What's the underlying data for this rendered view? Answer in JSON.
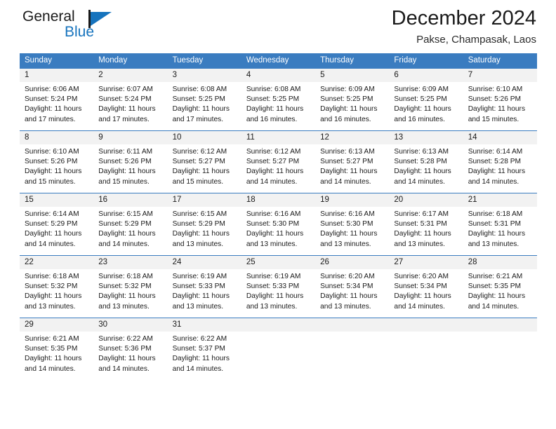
{
  "brand": {
    "name_part1": "General",
    "name_part2": "Blue",
    "logo_icon": "triangle-flag-icon",
    "accent_color": "#1673bd"
  },
  "header": {
    "title": "December 2024",
    "subtitle": "Pakse, Champasak, Laos"
  },
  "calendar": {
    "header_color": "#3a7cc0",
    "day_band_color": "#f2f2f2",
    "weekday_names": [
      "Sunday",
      "Monday",
      "Tuesday",
      "Wednesday",
      "Thursday",
      "Friday",
      "Saturday"
    ],
    "weeks": [
      [
        {
          "day": "1",
          "sunrise": "Sunrise: 6:06 AM",
          "sunset": "Sunset: 5:24 PM",
          "daylight_line1": "Daylight: 11 hours",
          "daylight_line2": "and 17 minutes."
        },
        {
          "day": "2",
          "sunrise": "Sunrise: 6:07 AM",
          "sunset": "Sunset: 5:24 PM",
          "daylight_line1": "Daylight: 11 hours",
          "daylight_line2": "and 17 minutes."
        },
        {
          "day": "3",
          "sunrise": "Sunrise: 6:08 AM",
          "sunset": "Sunset: 5:25 PM",
          "daylight_line1": "Daylight: 11 hours",
          "daylight_line2": "and 17 minutes."
        },
        {
          "day": "4",
          "sunrise": "Sunrise: 6:08 AM",
          "sunset": "Sunset: 5:25 PM",
          "daylight_line1": "Daylight: 11 hours",
          "daylight_line2": "and 16 minutes."
        },
        {
          "day": "5",
          "sunrise": "Sunrise: 6:09 AM",
          "sunset": "Sunset: 5:25 PM",
          "daylight_line1": "Daylight: 11 hours",
          "daylight_line2": "and 16 minutes."
        },
        {
          "day": "6",
          "sunrise": "Sunrise: 6:09 AM",
          "sunset": "Sunset: 5:25 PM",
          "daylight_line1": "Daylight: 11 hours",
          "daylight_line2": "and 16 minutes."
        },
        {
          "day": "7",
          "sunrise": "Sunrise: 6:10 AM",
          "sunset": "Sunset: 5:26 PM",
          "daylight_line1": "Daylight: 11 hours",
          "daylight_line2": "and 15 minutes."
        }
      ],
      [
        {
          "day": "8",
          "sunrise": "Sunrise: 6:10 AM",
          "sunset": "Sunset: 5:26 PM",
          "daylight_line1": "Daylight: 11 hours",
          "daylight_line2": "and 15 minutes."
        },
        {
          "day": "9",
          "sunrise": "Sunrise: 6:11 AM",
          "sunset": "Sunset: 5:26 PM",
          "daylight_line1": "Daylight: 11 hours",
          "daylight_line2": "and 15 minutes."
        },
        {
          "day": "10",
          "sunrise": "Sunrise: 6:12 AM",
          "sunset": "Sunset: 5:27 PM",
          "daylight_line1": "Daylight: 11 hours",
          "daylight_line2": "and 15 minutes."
        },
        {
          "day": "11",
          "sunrise": "Sunrise: 6:12 AM",
          "sunset": "Sunset: 5:27 PM",
          "daylight_line1": "Daylight: 11 hours",
          "daylight_line2": "and 14 minutes."
        },
        {
          "day": "12",
          "sunrise": "Sunrise: 6:13 AM",
          "sunset": "Sunset: 5:27 PM",
          "daylight_line1": "Daylight: 11 hours",
          "daylight_line2": "and 14 minutes."
        },
        {
          "day": "13",
          "sunrise": "Sunrise: 6:13 AM",
          "sunset": "Sunset: 5:28 PM",
          "daylight_line1": "Daylight: 11 hours",
          "daylight_line2": "and 14 minutes."
        },
        {
          "day": "14",
          "sunrise": "Sunrise: 6:14 AM",
          "sunset": "Sunset: 5:28 PM",
          "daylight_line1": "Daylight: 11 hours",
          "daylight_line2": "and 14 minutes."
        }
      ],
      [
        {
          "day": "15",
          "sunrise": "Sunrise: 6:14 AM",
          "sunset": "Sunset: 5:29 PM",
          "daylight_line1": "Daylight: 11 hours",
          "daylight_line2": "and 14 minutes."
        },
        {
          "day": "16",
          "sunrise": "Sunrise: 6:15 AM",
          "sunset": "Sunset: 5:29 PM",
          "daylight_line1": "Daylight: 11 hours",
          "daylight_line2": "and 14 minutes."
        },
        {
          "day": "17",
          "sunrise": "Sunrise: 6:15 AM",
          "sunset": "Sunset: 5:29 PM",
          "daylight_line1": "Daylight: 11 hours",
          "daylight_line2": "and 13 minutes."
        },
        {
          "day": "18",
          "sunrise": "Sunrise: 6:16 AM",
          "sunset": "Sunset: 5:30 PM",
          "daylight_line1": "Daylight: 11 hours",
          "daylight_line2": "and 13 minutes."
        },
        {
          "day": "19",
          "sunrise": "Sunrise: 6:16 AM",
          "sunset": "Sunset: 5:30 PM",
          "daylight_line1": "Daylight: 11 hours",
          "daylight_line2": "and 13 minutes."
        },
        {
          "day": "20",
          "sunrise": "Sunrise: 6:17 AM",
          "sunset": "Sunset: 5:31 PM",
          "daylight_line1": "Daylight: 11 hours",
          "daylight_line2": "and 13 minutes."
        },
        {
          "day": "21",
          "sunrise": "Sunrise: 6:18 AM",
          "sunset": "Sunset: 5:31 PM",
          "daylight_line1": "Daylight: 11 hours",
          "daylight_line2": "and 13 minutes."
        }
      ],
      [
        {
          "day": "22",
          "sunrise": "Sunrise: 6:18 AM",
          "sunset": "Sunset: 5:32 PM",
          "daylight_line1": "Daylight: 11 hours",
          "daylight_line2": "and 13 minutes."
        },
        {
          "day": "23",
          "sunrise": "Sunrise: 6:18 AM",
          "sunset": "Sunset: 5:32 PM",
          "daylight_line1": "Daylight: 11 hours",
          "daylight_line2": "and 13 minutes."
        },
        {
          "day": "24",
          "sunrise": "Sunrise: 6:19 AM",
          "sunset": "Sunset: 5:33 PM",
          "daylight_line1": "Daylight: 11 hours",
          "daylight_line2": "and 13 minutes."
        },
        {
          "day": "25",
          "sunrise": "Sunrise: 6:19 AM",
          "sunset": "Sunset: 5:33 PM",
          "daylight_line1": "Daylight: 11 hours",
          "daylight_line2": "and 13 minutes."
        },
        {
          "day": "26",
          "sunrise": "Sunrise: 6:20 AM",
          "sunset": "Sunset: 5:34 PM",
          "daylight_line1": "Daylight: 11 hours",
          "daylight_line2": "and 13 minutes."
        },
        {
          "day": "27",
          "sunrise": "Sunrise: 6:20 AM",
          "sunset": "Sunset: 5:34 PM",
          "daylight_line1": "Daylight: 11 hours",
          "daylight_line2": "and 14 minutes."
        },
        {
          "day": "28",
          "sunrise": "Sunrise: 6:21 AM",
          "sunset": "Sunset: 5:35 PM",
          "daylight_line1": "Daylight: 11 hours",
          "daylight_line2": "and 14 minutes."
        }
      ],
      [
        {
          "day": "29",
          "sunrise": "Sunrise: 6:21 AM",
          "sunset": "Sunset: 5:35 PM",
          "daylight_line1": "Daylight: 11 hours",
          "daylight_line2": "and 14 minutes."
        },
        {
          "day": "30",
          "sunrise": "Sunrise: 6:22 AM",
          "sunset": "Sunset: 5:36 PM",
          "daylight_line1": "Daylight: 11 hours",
          "daylight_line2": "and 14 minutes."
        },
        {
          "day": "31",
          "sunrise": "Sunrise: 6:22 AM",
          "sunset": "Sunset: 5:37 PM",
          "daylight_line1": "Daylight: 11 hours",
          "daylight_line2": "and 14 minutes."
        },
        {
          "day": "",
          "sunrise": "",
          "sunset": "",
          "daylight_line1": "",
          "daylight_line2": ""
        },
        {
          "day": "",
          "sunrise": "",
          "sunset": "",
          "daylight_line1": "",
          "daylight_line2": ""
        },
        {
          "day": "",
          "sunrise": "",
          "sunset": "",
          "daylight_line1": "",
          "daylight_line2": ""
        },
        {
          "day": "",
          "sunrise": "",
          "sunset": "",
          "daylight_line1": "",
          "daylight_line2": ""
        }
      ]
    ]
  }
}
